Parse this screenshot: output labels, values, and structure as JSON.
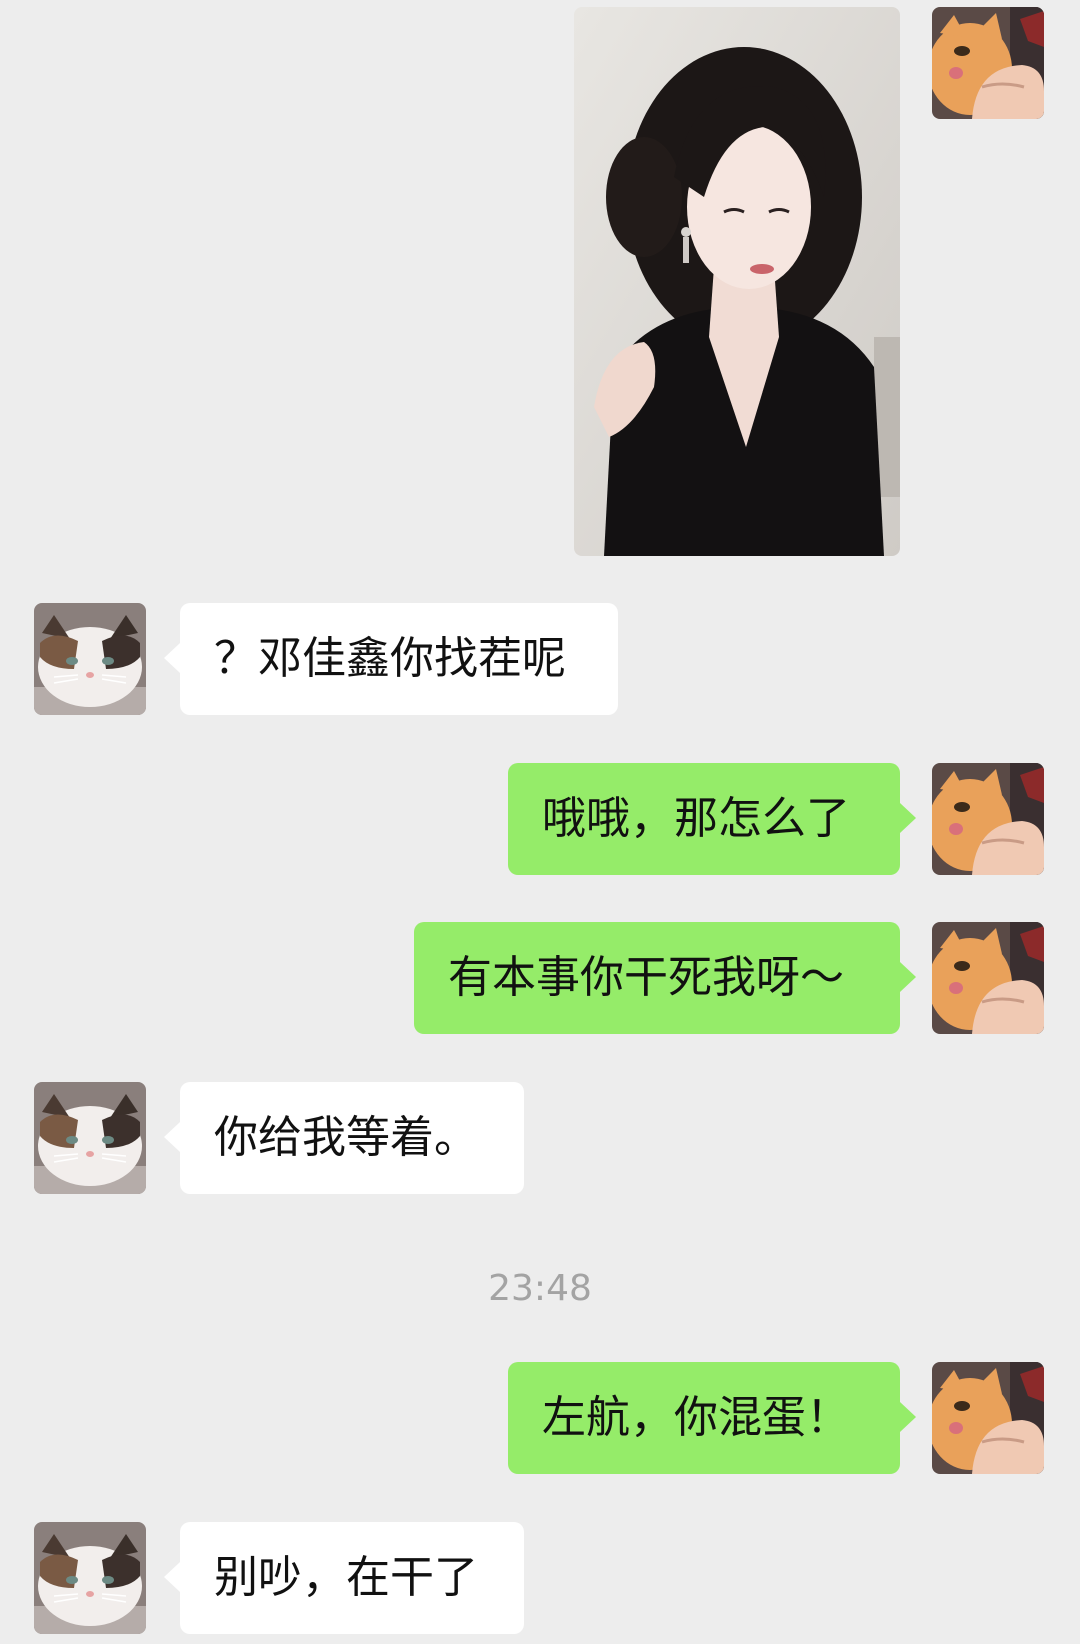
{
  "chat": {
    "messages": [
      {
        "side": "out",
        "type": "image",
        "image_icon": "portrait-photo"
      },
      {
        "side": "in",
        "text": "？邓佳鑫你找茬呢"
      },
      {
        "side": "out",
        "text": "哦哦，那怎么了"
      },
      {
        "side": "out",
        "text": "有本事你干死我呀～"
      },
      {
        "side": "in",
        "text": "你给我等着。"
      },
      {
        "side": "out",
        "text": "左航，你混蛋！"
      },
      {
        "side": "in",
        "text": "别吵，在干了"
      }
    ],
    "timestamp": "23:48"
  },
  "colors": {
    "background": "#ededed",
    "outgoing_bubble": "#95ec69",
    "incoming_bubble": "#ffffff",
    "timestamp_text": "#a3a3a3"
  },
  "icons": {
    "self_avatar": "orange-cat-avatar",
    "contact_avatar": "calico-cat-avatar"
  }
}
